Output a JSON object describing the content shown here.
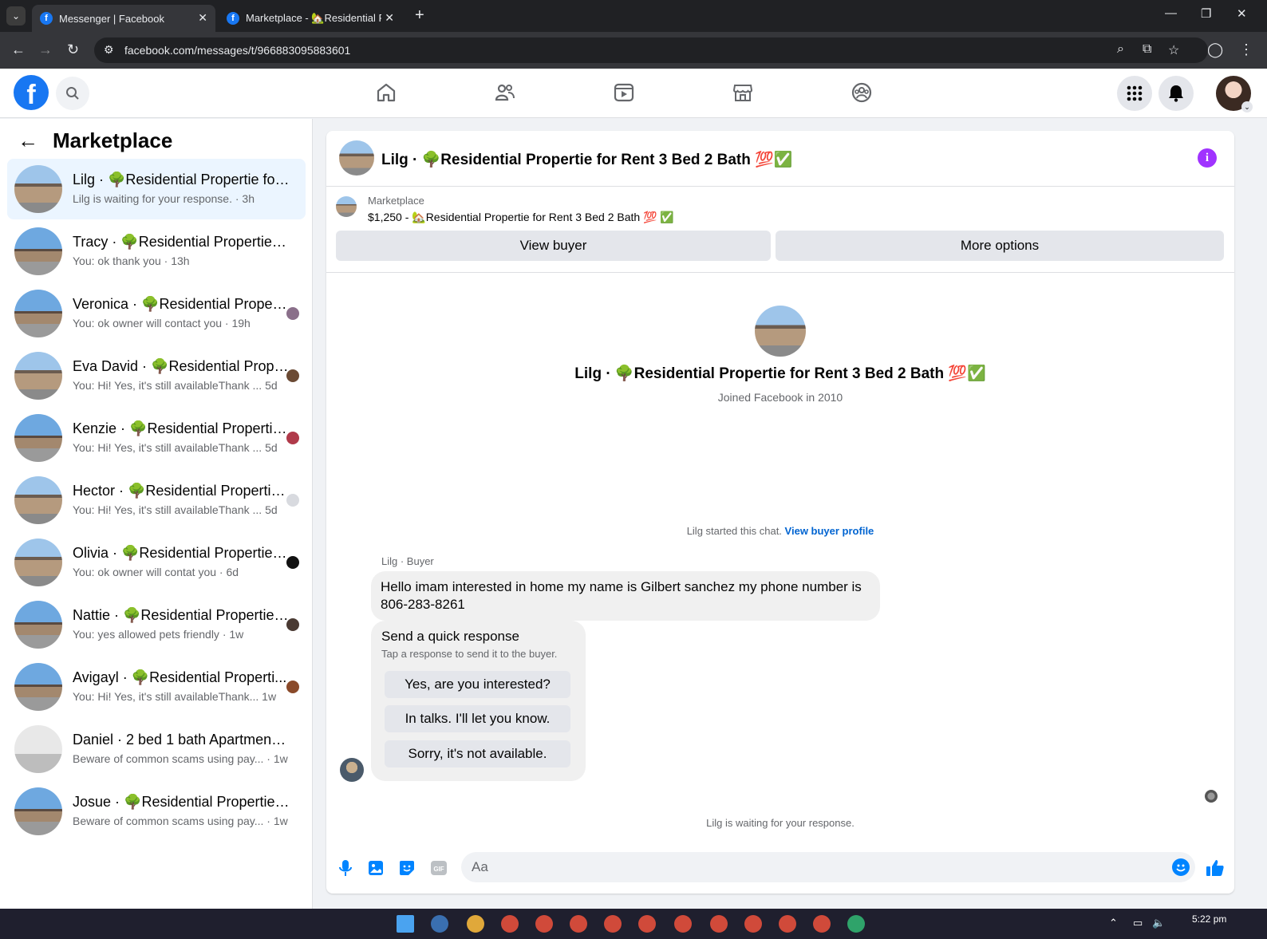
{
  "browser": {
    "tabs": [
      {
        "title": "Messenger | Facebook",
        "active": true
      },
      {
        "title": "Marketplace - 🏡Residential Pr",
        "active": false
      }
    ],
    "url": "facebook.com/messages/t/966883095883601"
  },
  "sidebar": {
    "title": "Marketplace",
    "conversations": [
      {
        "name": "Lilg · 🌳Residential Propertie for R...",
        "preview": "Lilg is waiting for your response. · 3h",
        "active": true,
        "thumb": "house"
      },
      {
        "name": "Tracy · 🌳Residential Propertie for ...",
        "preview": "You: ok thank you · 13h",
        "active": false,
        "thumb": "house2"
      },
      {
        "name": "Veronica · 🌳Residential Propert...",
        "preview": "You: ok owner will contact you · 19h",
        "active": false,
        "thumb": "house2"
      },
      {
        "name": "Eva David · 🌳Residential Prope...",
        "preview": "You: Hi! Yes, it's still availableThank ... 5d",
        "active": false,
        "thumb": "house"
      },
      {
        "name": "Kenzie · 🌳Residential Propertie...",
        "preview": "You: Hi! Yes, it's still availableThank ... 5d",
        "active": false,
        "thumb": "house2"
      },
      {
        "name": "Hector · 🌳Residential Propertie...",
        "preview": "You: Hi! Yes, it's still availableThank ... 5d",
        "active": false,
        "thumb": "house"
      },
      {
        "name": "Olivia · 🌳Residential Propertie f...",
        "preview": "You: ok owner will contat you · 6d",
        "active": false,
        "thumb": "house"
      },
      {
        "name": "Nattie · 🌳Residential Propertie ...",
        "preview": "You: yes allowed pets friendly · 1w",
        "active": false,
        "thumb": "house2"
      },
      {
        "name": "Avigayl · 🌳Residential Properti...",
        "preview": "You: Hi! Yes, it's still availableThank... 1w",
        "active": false,
        "thumb": "house2"
      },
      {
        "name": "Daniel · 2 bed 1 bath Apartment fo...",
        "preview": "Beware of common scams using pay... · 1w",
        "active": false,
        "thumb": "apt"
      },
      {
        "name": "Josue · 🌳Residential Propertie for...",
        "preview": "Beware of common scams using pay... · 1w",
        "active": false,
        "thumb": "house2"
      }
    ]
  },
  "chat": {
    "header_name": "Lilg · 🌳Residential Propertie for Rent 3 Bed 2 Bath 💯✅",
    "listing": {
      "label": "Marketplace",
      "price_line": "$1,250 - 🏡Residential Propertie for Rent 3 Bed 2 Bath 💯 ✅",
      "view_buyer": "View buyer",
      "more_options": "More options"
    },
    "profile": {
      "name": "Lilg · 🌳Residential Propertie for Rent 3 Bed 2 Bath 💯✅",
      "joined": "Joined Facebook in 2010"
    },
    "started_text": "Lilg started this chat.",
    "view_buyer_profile": "View buyer profile",
    "sender_label": "Lilg · Buyer",
    "message": "Hello imam interested in home my name is Gilbert sanchez my phone number is 806-283-8261",
    "quick_response": {
      "title": "Send a quick response",
      "subtitle": "Tap a response to send it to the buyer.",
      "options": [
        "Yes, are you interested?",
        "In talks. I'll let you know.",
        "Sorry, it's not available."
      ]
    },
    "waiting_text": "Lilg is waiting for your response.",
    "composer_placeholder": "Aa"
  },
  "taskbar": {
    "time": "5:22 pm"
  },
  "colors": {
    "brand": "#1877f2",
    "info": "#a033ff",
    "link": "#0064d1"
  }
}
